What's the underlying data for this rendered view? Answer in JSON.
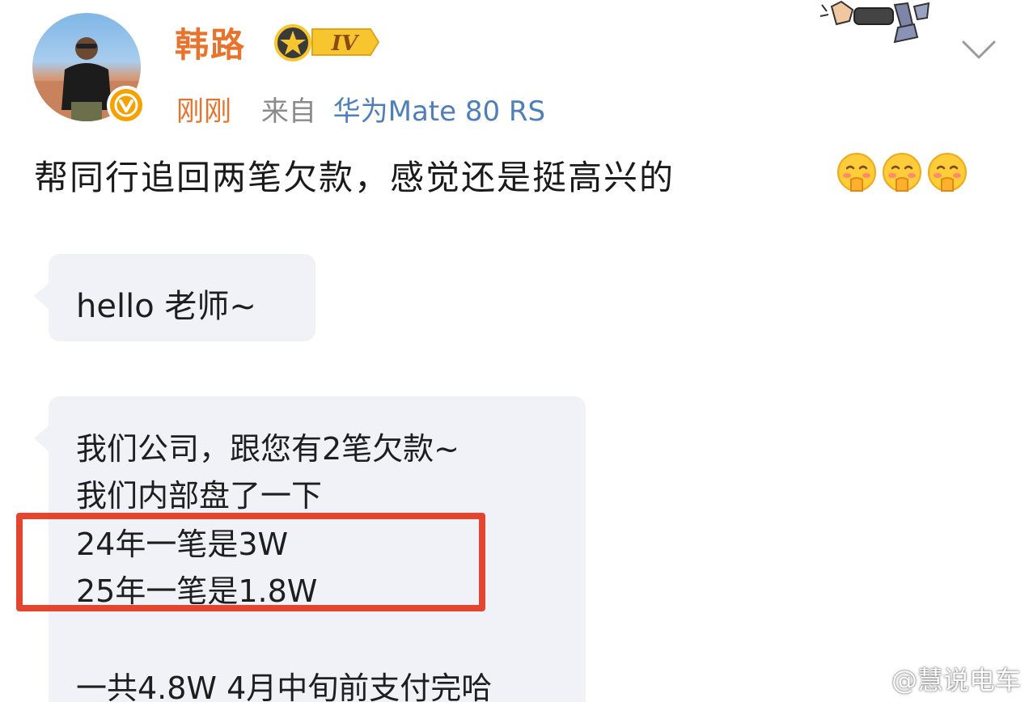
{
  "post": {
    "username": "韩路",
    "level": "IV",
    "time": "刚刚",
    "from_label": "来自",
    "device": "华为Mate 80 RS",
    "text": "帮同行追回两笔欠款，感觉还是挺高兴的",
    "emoji_icon": "shy-face-emoji"
  },
  "chat": {
    "greeting": "hello  老师~",
    "message_lines": [
      "我们公司，跟您有2笔欠款~",
      "我们内部盘了一下",
      "24年一笔是3W",
      "25年一笔是1.8W",
      "一共4.8W  4月中旬前支付完哈"
    ]
  },
  "watermark": {
    "text": "@慧说电车"
  },
  "colors": {
    "username": "#e8732c",
    "device_link": "#4f7fb8",
    "bubble_bg": "#f1f2f7",
    "highlight": "#e3452f"
  }
}
